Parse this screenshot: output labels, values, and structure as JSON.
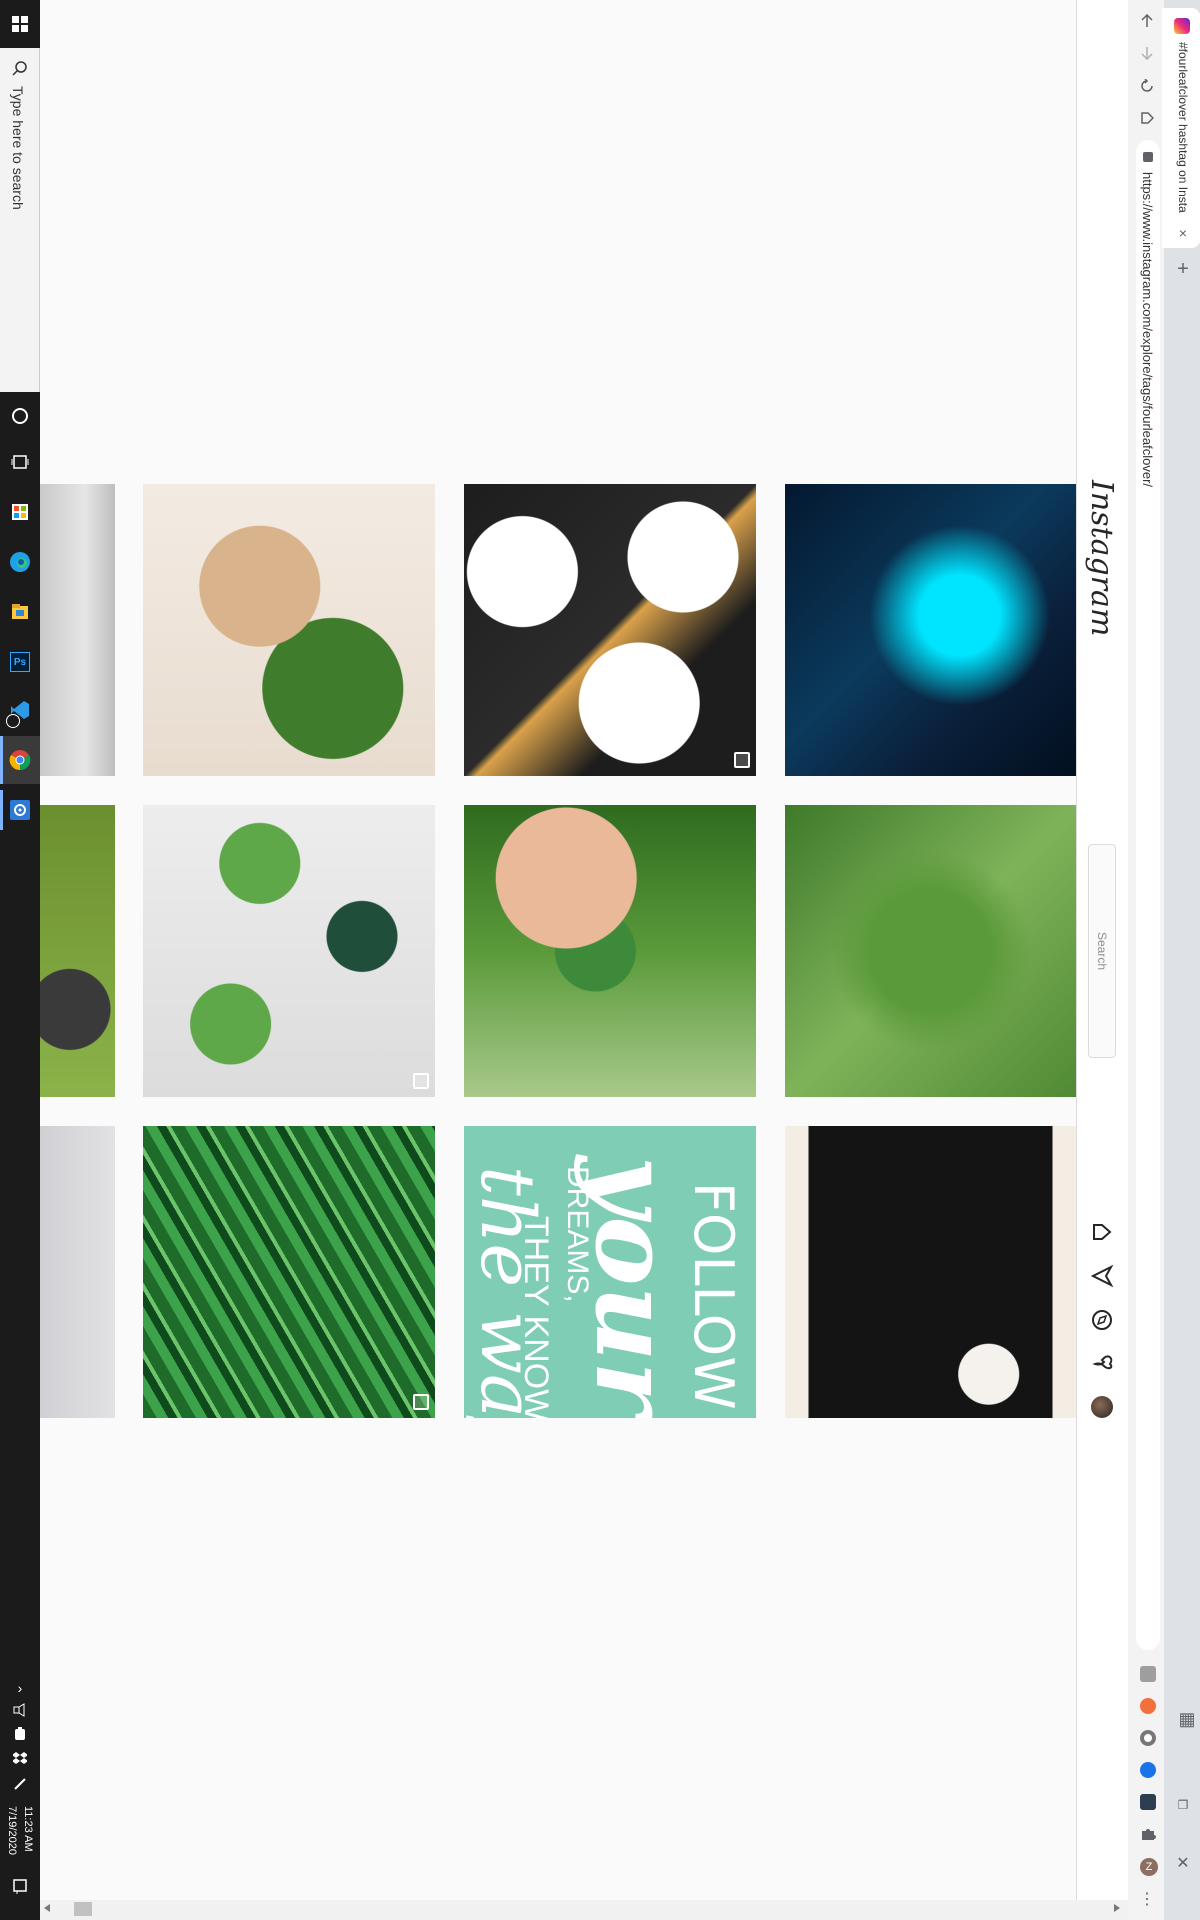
{
  "taskbar": {
    "search_placeholder": "Type here to search",
    "time": "11:23 AM",
    "date": "7/19/2020",
    "icons": [
      "windows-start-icon",
      "search-icon",
      "cortana-icon",
      "task-view-icon",
      "store-icon",
      "edge-icon",
      "file-explorer-icon",
      "photoshop-icon",
      "vs-code-icon",
      "chrome-icon",
      "settings-icon"
    ],
    "tray_icons": [
      "chevron-up-icon",
      "speaker-icon",
      "battery-icon",
      "dropbox-icon",
      "pen-icon"
    ],
    "photoshop_label": "Ps"
  },
  "browser": {
    "tab_title": "#fourleafclover hashtag on Insta",
    "tab_close": "×",
    "new_tab": "+",
    "url": "https://www.instagram.com/explore/tags/fourleafclover/",
    "window_buttons": {
      "close": "✕",
      "restore": "❐",
      "minimize": "–",
      "layout": "▦"
    },
    "nav_icons": [
      "back-icon",
      "forward-icon",
      "reload-icon",
      "home-icon"
    ],
    "extensions": [
      "grammarly-extension-icon",
      "orange-extension-icon",
      "grey-extension-icon",
      "blue-extension-icon",
      "dark-extension-icon",
      "puzzle-extension-icon",
      "profile-avatar"
    ],
    "profile_initial": "Z",
    "menu": "⋮",
    "colors": {
      "tabstrip": "#dee1e6",
      "toolbar": "#f3f3f3"
    }
  },
  "instagram": {
    "logo": "Instagram",
    "search_placeholder": "Search",
    "nav": [
      "home-icon",
      "direct-icon",
      "explore-icon",
      "activity-heart-icon",
      "profile-avatar"
    ]
  },
  "post_grid": {
    "rows": [
      [
        {
          "name": "post-partial-husky",
          "cls": "t-husky1",
          "multi": false
        },
        {
          "name": "post-owl-figurine-clover",
          "cls": "t-owl",
          "multi": false
        },
        {
          "name": "post-embroidered-cards",
          "cls": "t-cards",
          "multi": true
        },
        {
          "name": "post-anime-art",
          "cls": "t-anime",
          "multi": false
        }
      ],
      [
        {
          "name": "post-partial-dog-grass",
          "cls": "t-dog",
          "multi": false
        },
        {
          "name": "post-crochet-turtles",
          "cls": "t-turtles",
          "multi": true
        },
        {
          "name": "post-hand-picking-clover",
          "cls": "t-hand",
          "multi": false
        },
        {
          "name": "post-clover-patch",
          "cls": "t-patch",
          "multi": false
        }
      ],
      [
        {
          "name": "post-partial-grey",
          "cls": "t-grey",
          "multi": false
        },
        {
          "name": "post-clover-pattern",
          "cls": "t-pattern",
          "multi": true
        },
        {
          "name": "post-quote-card",
          "cls": "t-quote",
          "multi": false
        },
        {
          "name": "post-black-dress",
          "cls": "t-dress",
          "multi": false
        }
      ]
    ],
    "quote_text": {
      "line1": "FOLLOW",
      "line2": "your",
      "line3": "DREAMS,",
      "line4": "THEY KNOW",
      "line5": "the way"
    }
  }
}
